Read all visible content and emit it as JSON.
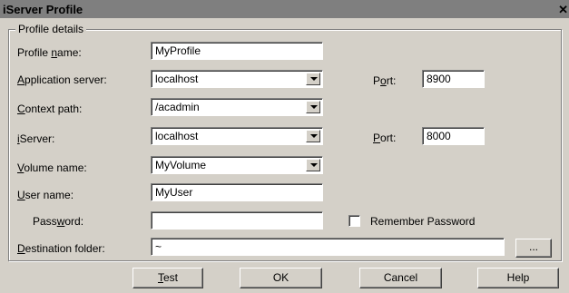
{
  "window": {
    "title": "iServer Profile",
    "close_glyph": "✕"
  },
  "group": {
    "legend": "Profile details"
  },
  "fields": {
    "profile_name": {
      "label_pre": "Profile ",
      "label_key": "n",
      "label_post": "ame:",
      "value": "MyProfile"
    },
    "app_server": {
      "label_pre": "",
      "label_key": "A",
      "label_post": "pplication server:",
      "value": "localhost"
    },
    "context_path": {
      "label_pre": "",
      "label_key": "C",
      "label_post": "ontext path:",
      "value": "/acadmin"
    },
    "iserver": {
      "label_pre": "",
      "label_key": "i",
      "label_post": "Server:",
      "value": "localhost"
    },
    "volume_name": {
      "label_pre": "",
      "label_key": "V",
      "label_post": "olume name:",
      "value": "MyVolume"
    },
    "user_name": {
      "label_pre": "",
      "label_key": "U",
      "label_post": "ser name:",
      "value": "MyUser"
    },
    "password": {
      "label_pre": "Pass",
      "label_key": "w",
      "label_post": "ord:",
      "value": ""
    },
    "destination": {
      "label_pre": "",
      "label_key": "D",
      "label_post": "estination folder:",
      "value": "~"
    }
  },
  "ports": {
    "app_port": {
      "label_pre": "P",
      "label_key": "o",
      "label_post": "rt:",
      "value": "8900"
    },
    "iserver_port": {
      "label_pre": "",
      "label_key": "P",
      "label_post": "ort:",
      "value": "8000"
    }
  },
  "remember": {
    "label": "Remember Password",
    "checked": false
  },
  "browse": {
    "label": "..."
  },
  "buttons": {
    "test": {
      "pre": "",
      "key": "T",
      "post": "est"
    },
    "ok": "OK",
    "cancel": "Cancel",
    "help": "Help"
  }
}
